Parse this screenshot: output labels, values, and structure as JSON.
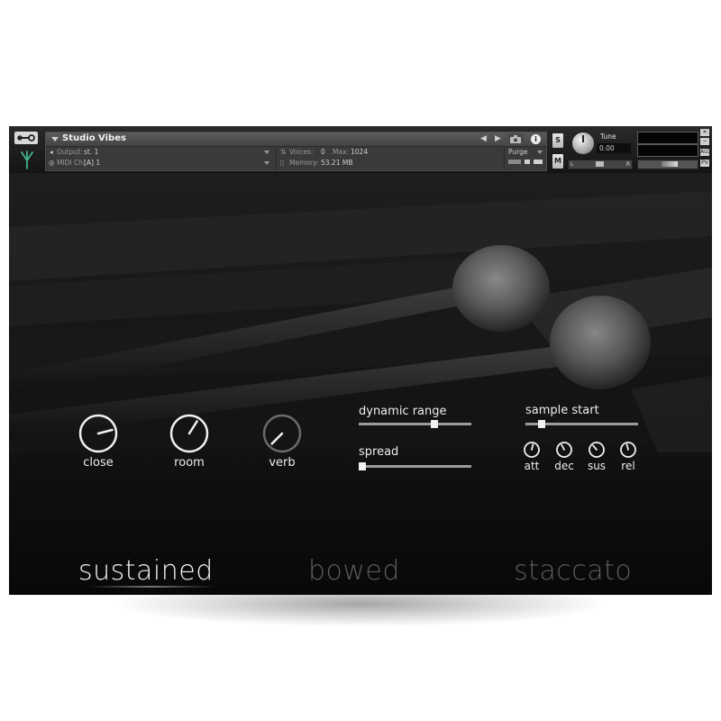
{
  "header": {
    "instrument_name": "Studio Vibes",
    "output_label": "Output:",
    "output_value": "st. 1",
    "midi_label": "MIDI Ch:",
    "midi_value": "[A]  1",
    "voices_label": "Voices:",
    "voices_value": "0",
    "max_label": "Max:",
    "max_value": "1024",
    "memory_label": "Memory:",
    "memory_value": "53.21 MB",
    "purge_label": "Purge",
    "solo_label": "S",
    "mute_label": "M",
    "tune_label": "Tune",
    "tune_value": "0.00",
    "pan_left": "L",
    "pan_right": "R",
    "aux_label": "AUX",
    "pv_label": "PV"
  },
  "controls": {
    "knobs": [
      {
        "label": "close",
        "value": 0.78
      },
      {
        "label": "room",
        "value": 0.62
      },
      {
        "label": "verb",
        "value": 0.0
      }
    ],
    "sliders": [
      {
        "label": "dynamic range",
        "value": 0.68
      },
      {
        "label": "spread",
        "value": 0.0
      },
      {
        "label": "sample start",
        "value": 0.12
      }
    ],
    "envelope": [
      {
        "label": "att",
        "value": 0.55
      },
      {
        "label": "dec",
        "value": 0.4
      },
      {
        "label": "sus",
        "value": 0.35
      },
      {
        "label": "rel",
        "value": 0.45
      }
    ]
  },
  "articulations": {
    "sustained": "sustained",
    "bowed": "bowed",
    "staccato": "staccato",
    "selected": "sustained"
  },
  "colors": {
    "active_text": "#f2f2f2",
    "inactive_text": "#5c5c5c",
    "logo_accent": "#3fb58a"
  }
}
